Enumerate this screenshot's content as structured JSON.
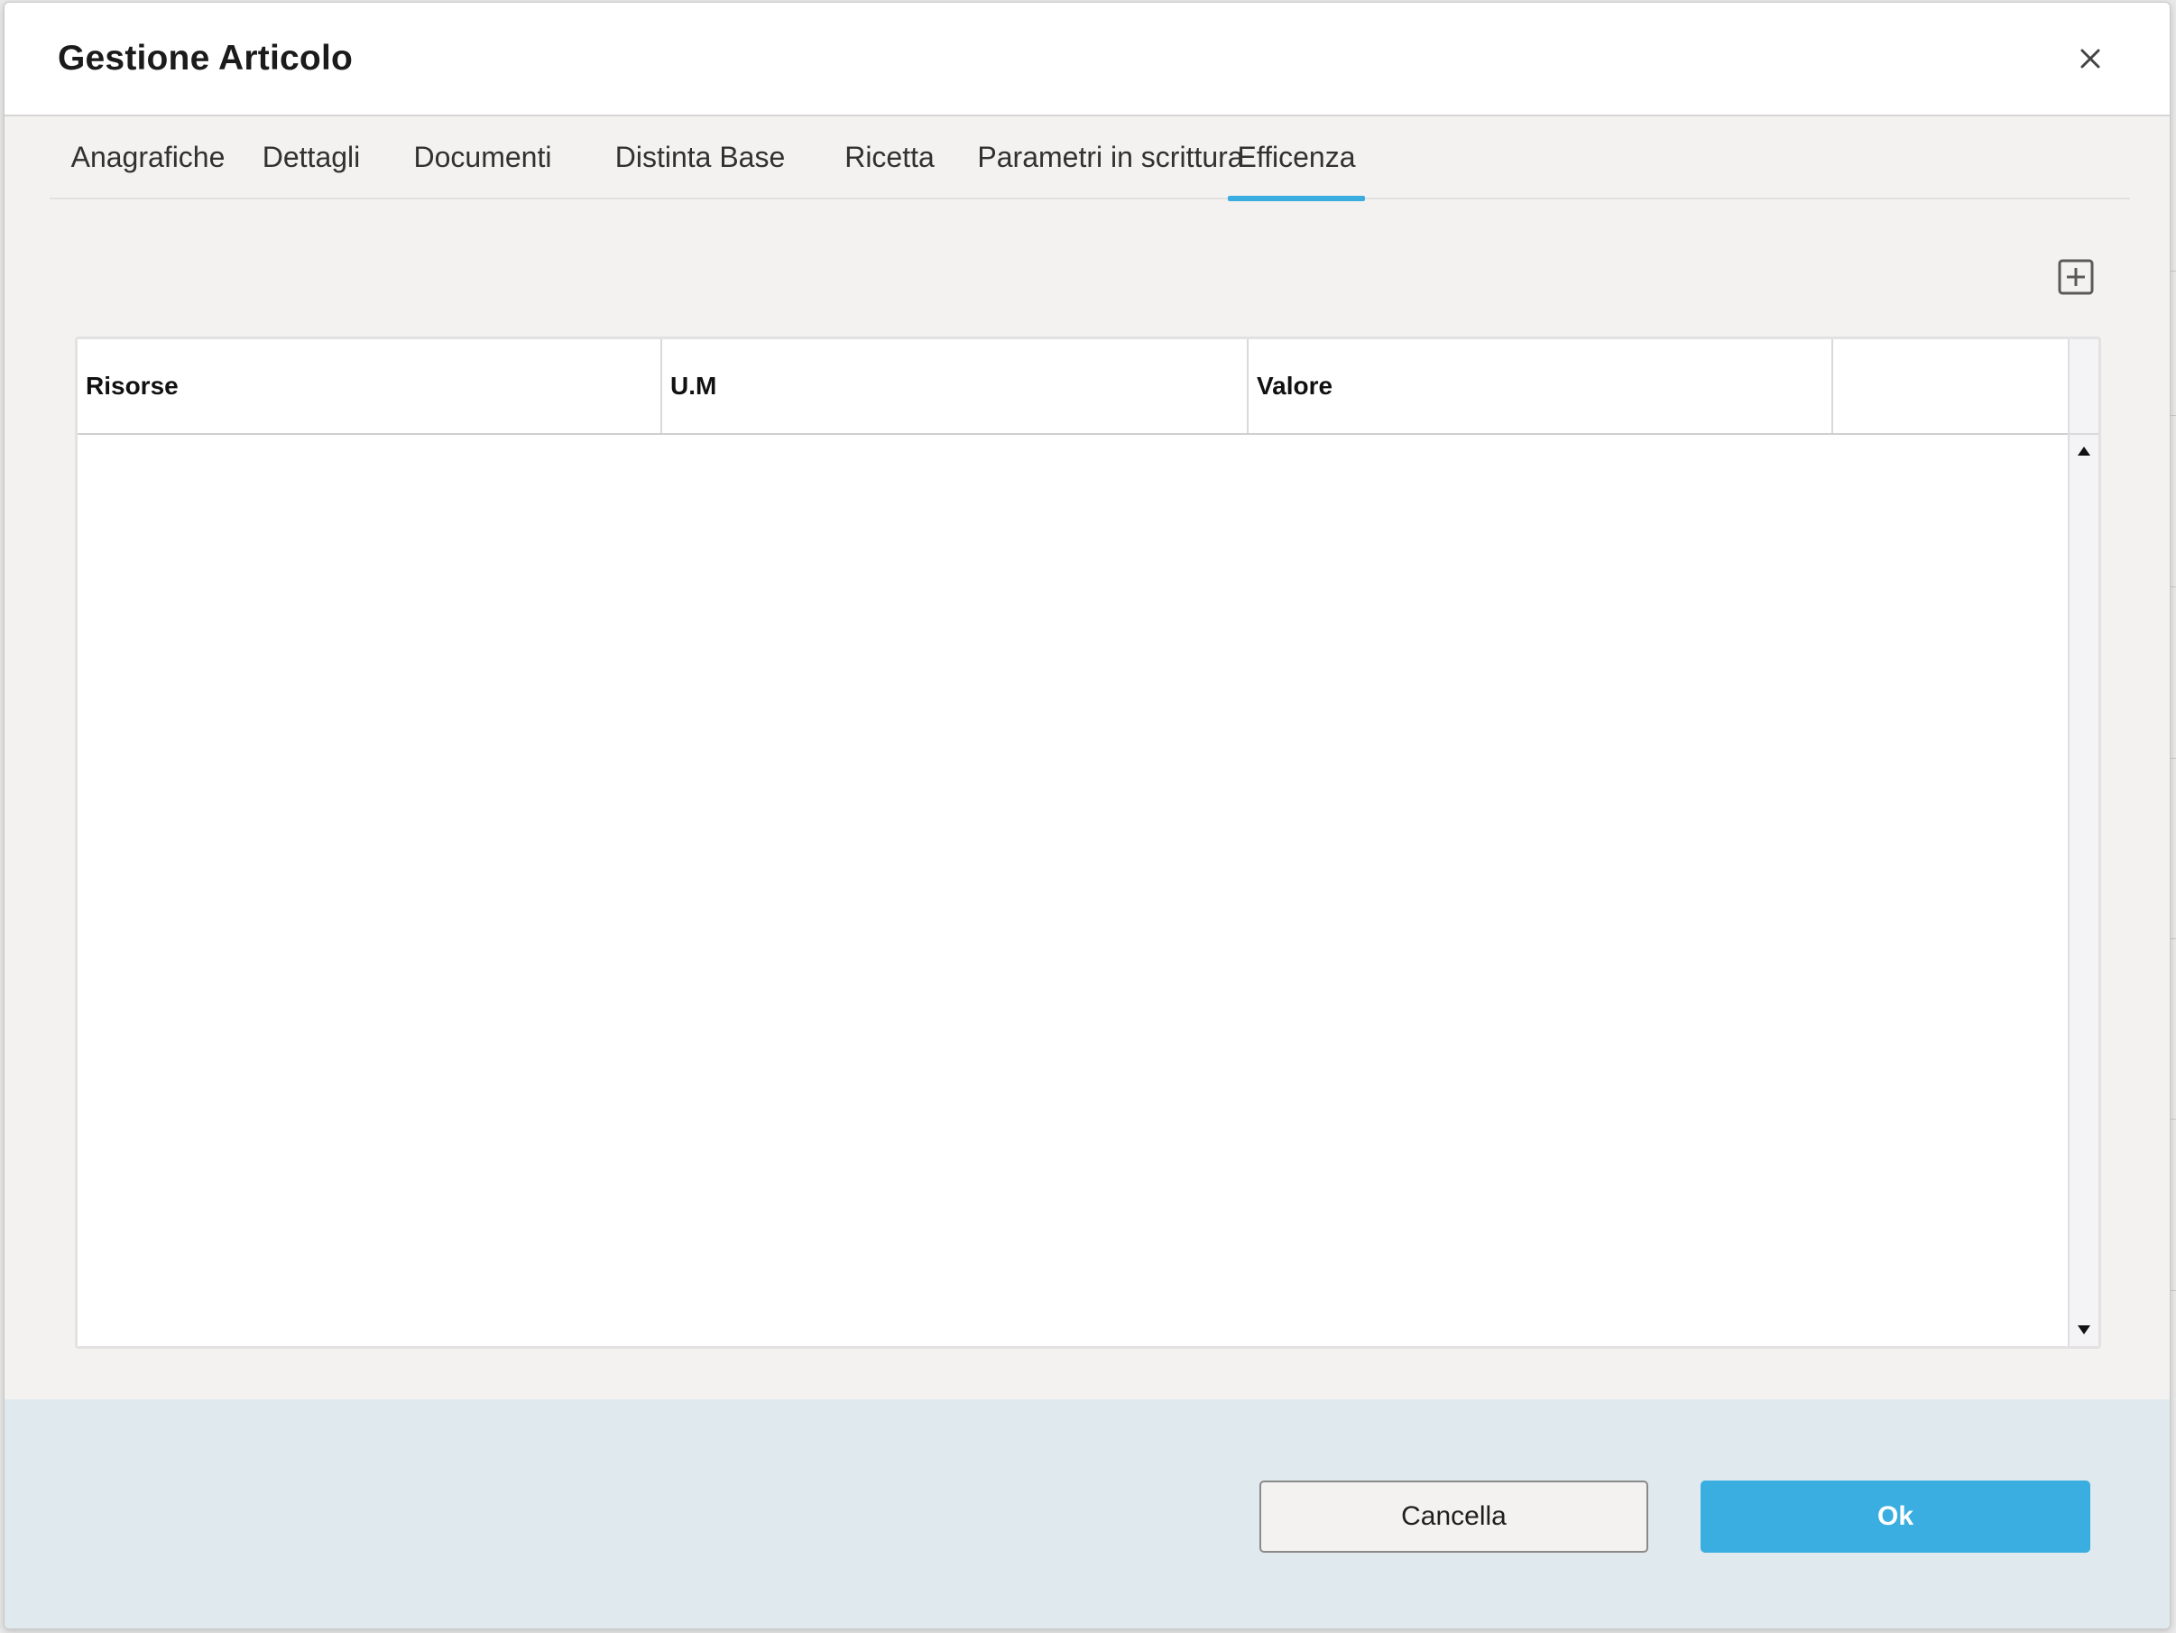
{
  "dialog": {
    "title": "Gestione Articolo",
    "close_icon": "close-icon"
  },
  "tabs": [
    {
      "label": "Anagrafiche",
      "active": false
    },
    {
      "label": "Dettagli",
      "active": false
    },
    {
      "label": "Documenti",
      "active": false
    },
    {
      "label": "Distinta Base",
      "active": false
    },
    {
      "label": "Ricetta",
      "active": false
    },
    {
      "label": "Parametri in scrittura",
      "active": false
    },
    {
      "label": "Efficenza",
      "active": true
    }
  ],
  "toolbar": {
    "add_icon": "plus-square-icon"
  },
  "grid": {
    "columns": [
      "Risorse",
      "U.M",
      "Valore",
      ""
    ],
    "rows": []
  },
  "footer": {
    "cancel_label": "Cancella",
    "ok_label": "Ok"
  },
  "colors": {
    "accent": "#3aaee0",
    "footer_bg": "#e0eaee",
    "dialog_bg": "#f3f2f1"
  }
}
